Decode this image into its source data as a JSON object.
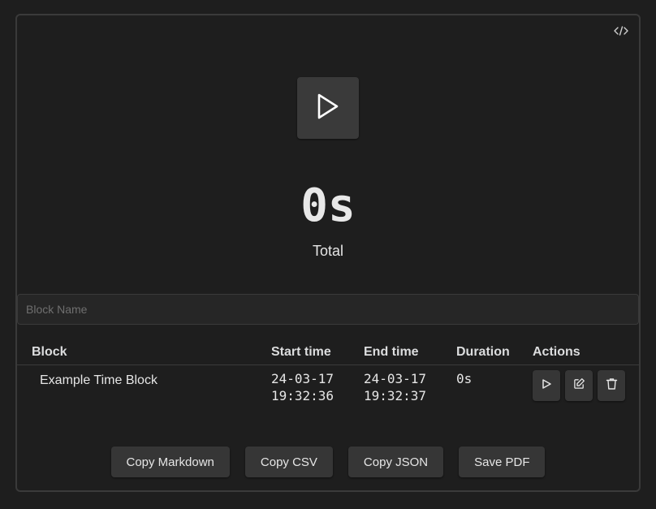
{
  "header": {
    "code_icon": "code-brackets-icon"
  },
  "timer": {
    "start_icon": "play-icon",
    "total_value": "0s",
    "total_label": "Total"
  },
  "block_name_input": {
    "value": "",
    "placeholder": "Block Name"
  },
  "table": {
    "headers": {
      "block": "Block",
      "start": "Start time",
      "end": "End time",
      "duration": "Duration",
      "actions": "Actions"
    },
    "rows": [
      {
        "name": "Example Time Block",
        "start_date": "24-03-17",
        "start_time": "19:32:36",
        "end_date": "24-03-17",
        "end_time": "19:32:37",
        "duration": "0s",
        "action_icons": [
          "play-icon",
          "edit-icon",
          "trash-icon"
        ]
      }
    ]
  },
  "export": {
    "copy_markdown": "Copy Markdown",
    "copy_csv": "Copy CSV",
    "copy_json": "Copy JSON",
    "save_pdf": "Save PDF"
  },
  "colors": {
    "background": "#1e1e1e",
    "button": "#363636",
    "border": "#3a3a3a",
    "text": "#dcddde"
  }
}
